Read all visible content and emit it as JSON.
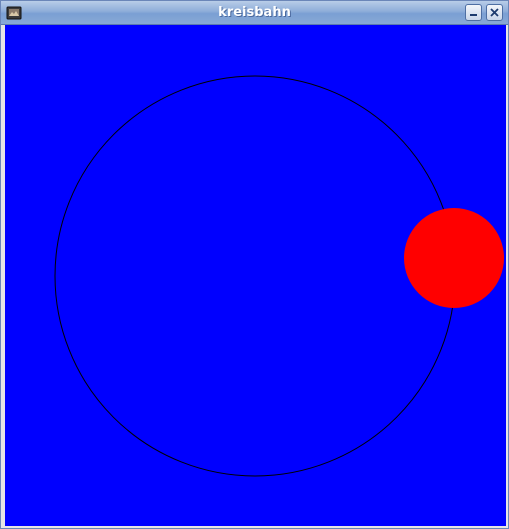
{
  "window": {
    "title": "kreisbahn",
    "buttons": {
      "minimize": "minimize-icon",
      "close": "close-icon"
    }
  },
  "canvas": {
    "background_color": "#0000ff",
    "orbit_color": "#000000",
    "ball_color": "#ff0000"
  }
}
